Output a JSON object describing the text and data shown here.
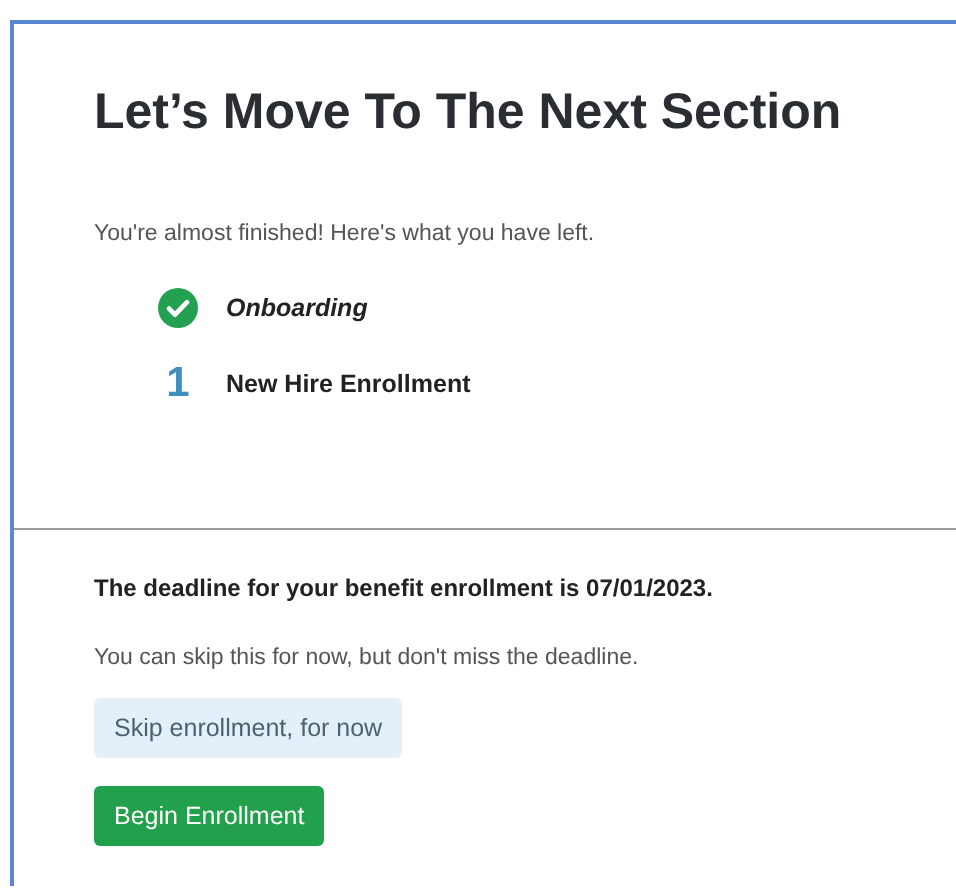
{
  "title": "Let’s Move To The Next Section",
  "subtitle": "You're almost finished! Here's what you have left.",
  "steps": [
    {
      "kind": "done",
      "label": "Onboarding"
    },
    {
      "kind": "pending",
      "number": "1",
      "label": "New Hire Enrollment"
    }
  ],
  "deadline": "The deadline for your benefit enrollment is 07/01/2023.",
  "note": "You can skip this for now, but don't miss the deadline.",
  "buttons": [
    {
      "kind": "secondary",
      "label": "Skip enrollment, for now"
    },
    {
      "kind": "primary",
      "label": "Begin Enrollment"
    }
  ]
}
